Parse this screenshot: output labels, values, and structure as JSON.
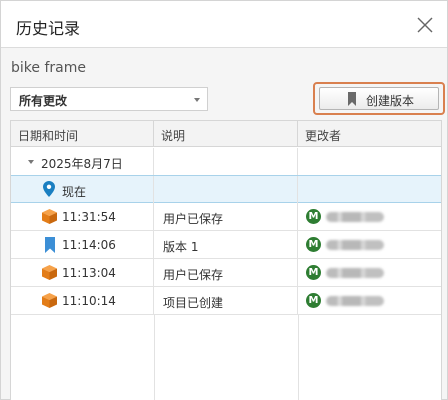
{
  "header": {
    "title": "历史记录"
  },
  "document": {
    "name": "bike frame"
  },
  "filter": {
    "selected": "所有更改"
  },
  "toolbar": {
    "create_version_label": "创建版本"
  },
  "table": {
    "columns": [
      "日期和时间",
      "说明",
      "更改者"
    ],
    "group": {
      "label": "2025年8月7日"
    },
    "current": {
      "label": "现在"
    },
    "rows": [
      {
        "time": "11:31:54",
        "icon": "package-icon",
        "description": "用户已保存",
        "avatar": "M"
      },
      {
        "time": "11:14:06",
        "icon": "bookmark-icon",
        "description": "版本 1",
        "avatar": "M"
      },
      {
        "time": "11:13:04",
        "icon": "package-icon",
        "description": "用户已保存",
        "avatar": "M"
      },
      {
        "time": "11:10:14",
        "icon": "package-icon",
        "description": "项目已创建",
        "avatar": "M"
      }
    ]
  },
  "colors": {
    "accent": "#1a7fc1",
    "highlight": "#d9804f",
    "avatar": "#2e7d32",
    "package": "#f08a24"
  }
}
